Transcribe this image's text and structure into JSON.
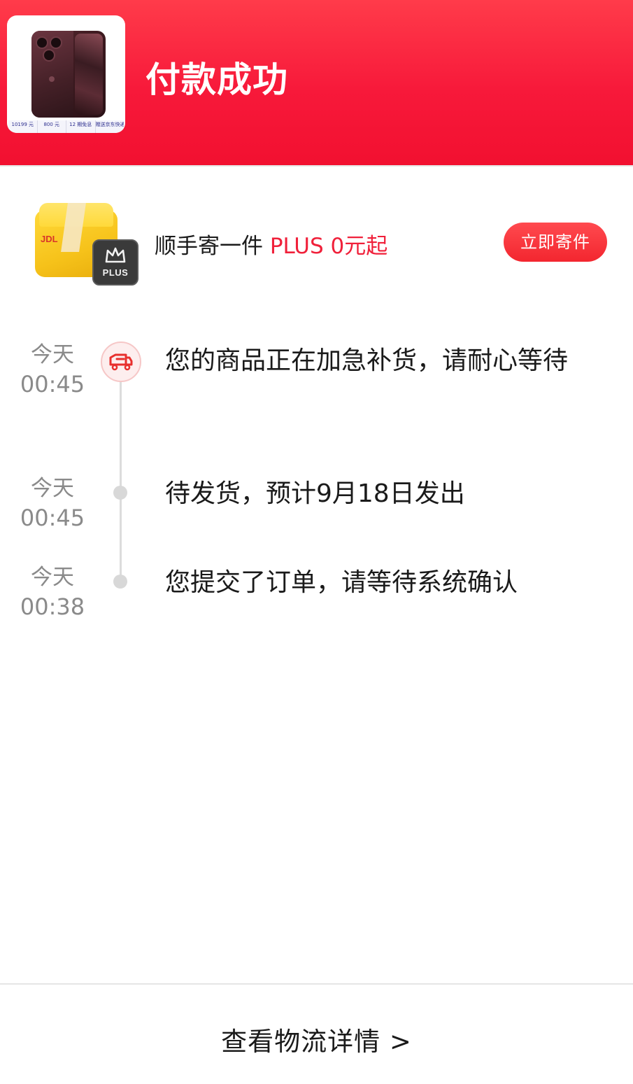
{
  "header": {
    "title": "付款成功",
    "thumbnail": {
      "specs": [
        "10199 元",
        "800 元",
        "12 期免息",
        "赠送京东快递"
      ]
    }
  },
  "promo": {
    "box_logo": "JDL",
    "badge_text": "PLUS",
    "text_main": "顺手寄一件 ",
    "text_highlight": "PLUS 0元起",
    "button_label": "立即寄件",
    "highlight_color": "#f0203a"
  },
  "timeline": [
    {
      "day": "今天",
      "time": "00:45",
      "text": "您的商品正在加急补货，请耐心等待",
      "icon": "truck-icon"
    },
    {
      "day": "今天",
      "time": "00:45",
      "text": "待发货，预计9月18日发出"
    },
    {
      "day": "今天",
      "time": "00:38",
      "text": "您提交了订单，请等待系统确认"
    }
  ],
  "footer": {
    "link_label": "查看物流详情 >"
  }
}
